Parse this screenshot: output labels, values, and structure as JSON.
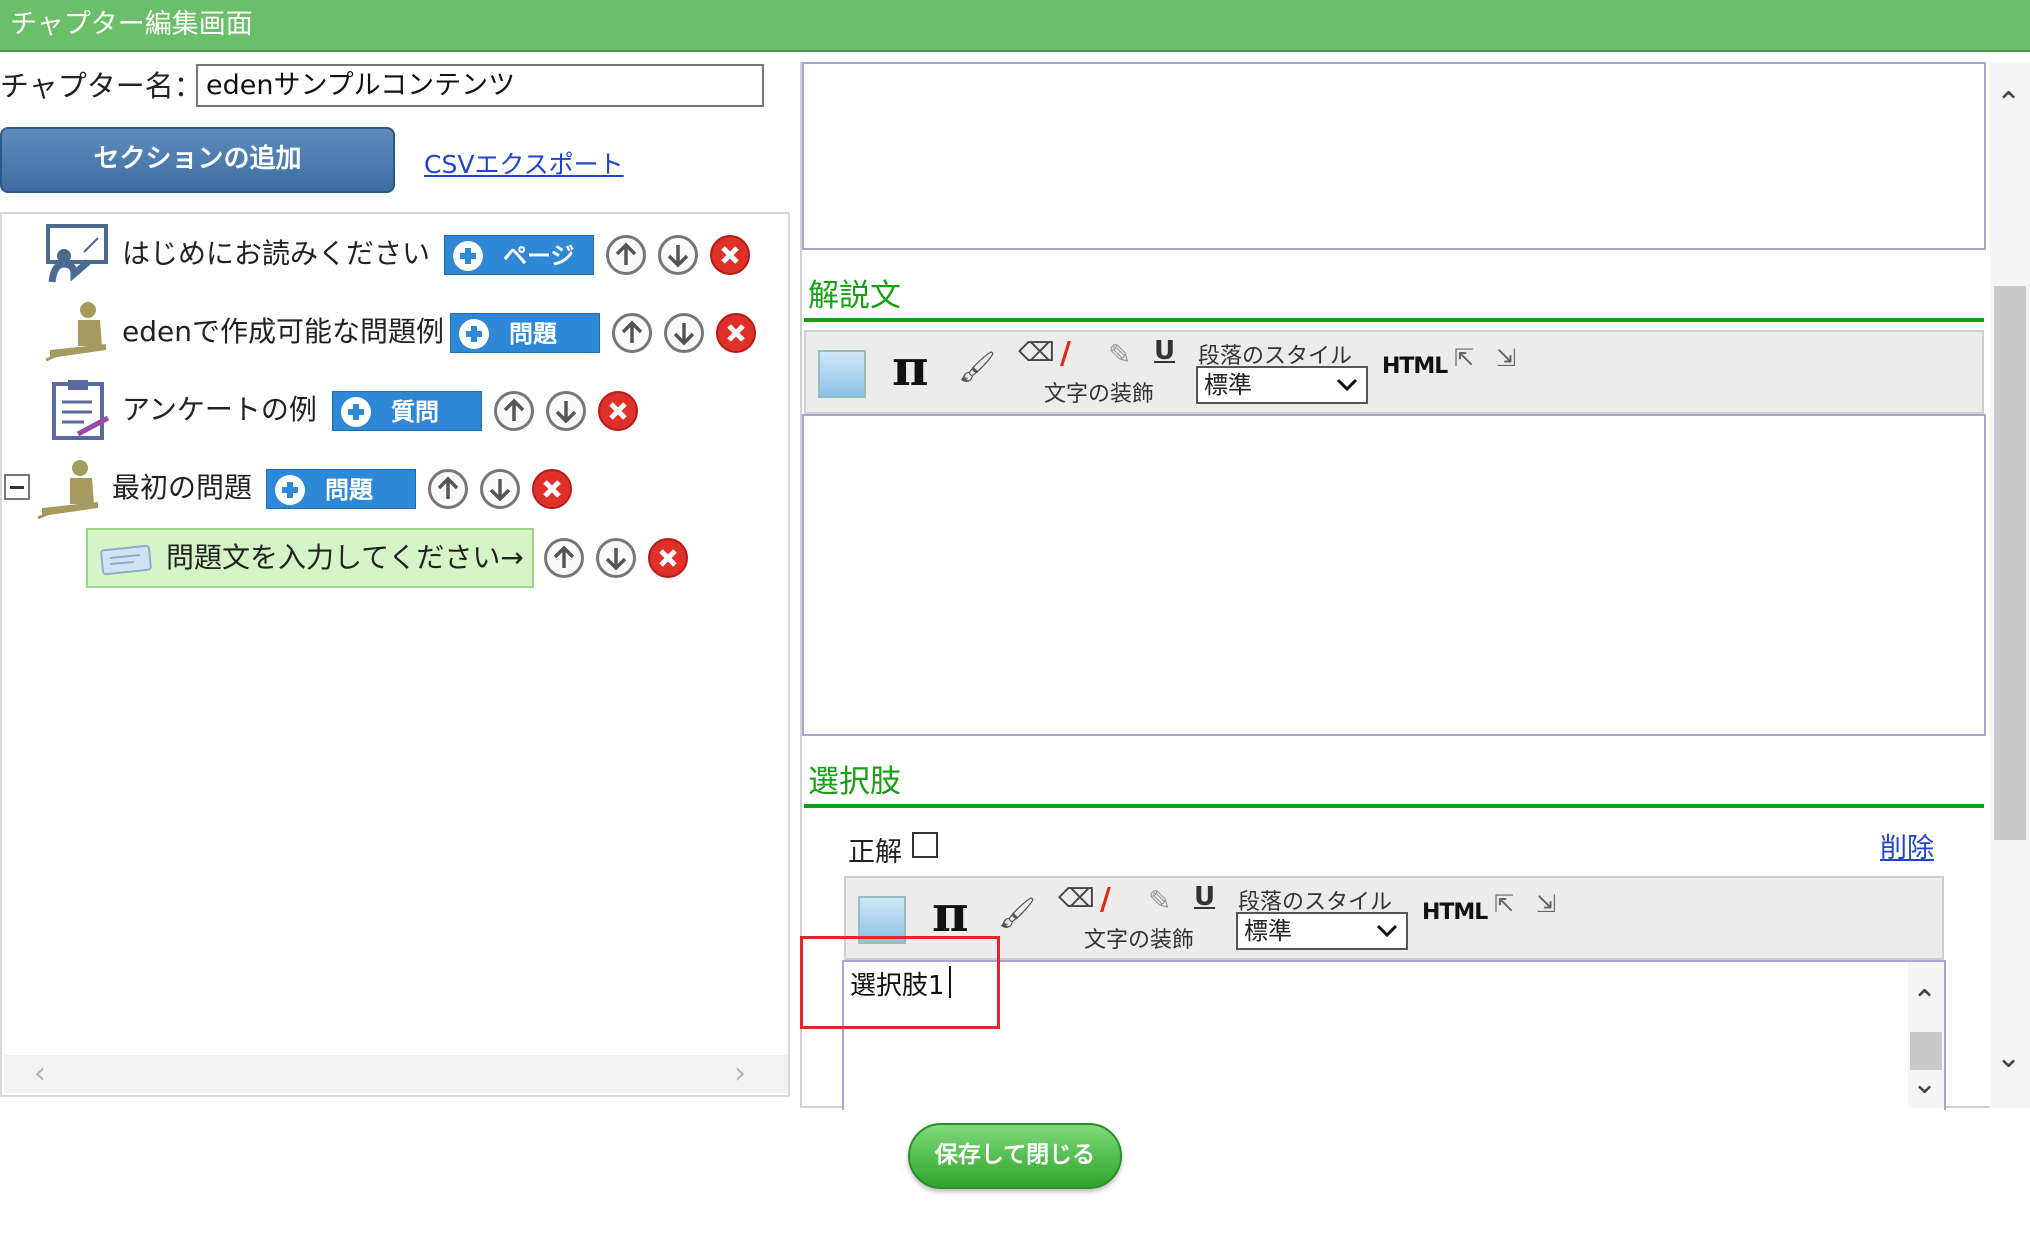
{
  "window": {
    "title": "チャプター編集画面"
  },
  "chapter": {
    "label": "チャプター名：",
    "name_value": "edenサンプルコンテンツ"
  },
  "actions": {
    "add_section": "セクションの追加",
    "csv_export": "CSVエクスポート",
    "save_close": "保存して閉じる"
  },
  "tree": {
    "nodes": [
      {
        "label": "はじめにお読みください",
        "add_label": "ページ",
        "icon": "presentation-icon"
      },
      {
        "label": "edenで作成可能な問題例",
        "add_label": "問題",
        "icon": "person-desk-icon"
      },
      {
        "label": "アンケートの例",
        "add_label": "質問",
        "icon": "clipboard-icon"
      },
      {
        "label": "最初の問題",
        "add_label": "問題",
        "icon": "person-desk-icon"
      },
      {
        "label": "問題文を入力してください→",
        "icon": "card-icon",
        "selected": true
      }
    ]
  },
  "editor": {
    "explanation_title": "解説文",
    "choices_title": "選択肢",
    "toolbar": {
      "decoration_label": "文字の装飾",
      "paragraph_label": "段落のスタイル",
      "paragraph_value": "標準",
      "html_label": "HTML"
    },
    "choice": {
      "correct_label": "正解",
      "correct_checked": false,
      "delete_label": "削除",
      "text": "選択肢1"
    }
  },
  "colors": {
    "titlebar": "#6cbf6a",
    "section_green": "#16a010",
    "add_button_blue": "#2e88d6",
    "highlight_red": "#e0282a"
  }
}
